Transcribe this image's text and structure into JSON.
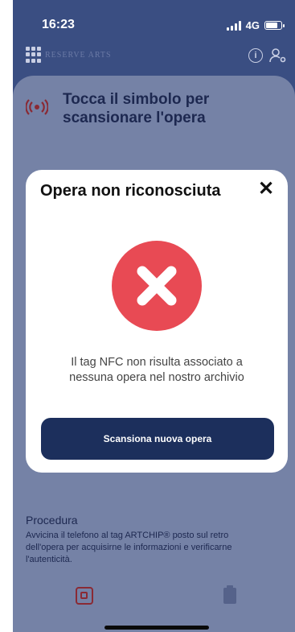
{
  "status_bar": {
    "time": "16:23",
    "network": "4G"
  },
  "header": {
    "logo_text": "RESERVE ARTS"
  },
  "scan": {
    "title": "Tocca il simbolo per scansionare l'opera"
  },
  "procedure": {
    "title": "Procedura",
    "text": "Avvicina il telefono al tag ARTCHIP® posto sul retro dell'opera per acquisirne le informazioni e verificarne l'autenticità."
  },
  "modal": {
    "title": "Opera non riconosciuta",
    "close_label": "✕",
    "message": "Il tag NFC non risulta associato a nessuna opera nel nostro archivio",
    "button_label": "Scansiona nuova opera"
  },
  "colors": {
    "error": "#e84a54",
    "primary": "#1c2f5c",
    "header_bg": "#3a4e82"
  },
  "icons": [
    "grid-icon",
    "info-icon",
    "user-settings-icon",
    "nfc-icon",
    "error-icon",
    "close-icon",
    "scan-tab-icon",
    "archive-tab-icon"
  ]
}
